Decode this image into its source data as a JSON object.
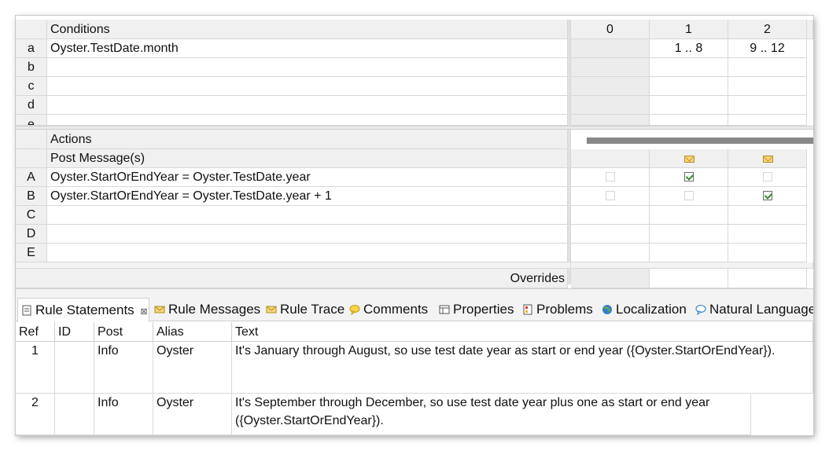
{
  "decision_table": {
    "conditions_header": "Conditions",
    "column_headers": [
      "0",
      "1",
      "2"
    ],
    "conditions": [
      {
        "letter": "a",
        "expr": "Oyster.TestDate.month",
        "values": [
          "",
          "1 .. 8",
          "9 .. 12"
        ]
      },
      {
        "letter": "b",
        "expr": "",
        "values": [
          "",
          "",
          ""
        ]
      },
      {
        "letter": "c",
        "expr": "",
        "values": [
          "",
          "",
          ""
        ]
      },
      {
        "letter": "d",
        "expr": "",
        "values": [
          "",
          "",
          ""
        ]
      },
      {
        "letter": "e",
        "expr": "",
        "values": [
          "",
          "",
          ""
        ]
      }
    ],
    "actions_header": "Actions",
    "post_message_label": "Post Message(s)",
    "actions": [
      {
        "letter": "A",
        "expr": "Oyster.StartOrEndYear = Oyster.TestDate.year",
        "checks": [
          false,
          true,
          false
        ]
      },
      {
        "letter": "B",
        "expr": "Oyster.StartOrEndYear = Oyster.TestDate.year + 1",
        "checks": [
          false,
          false,
          true
        ]
      },
      {
        "letter": "C",
        "expr": "",
        "checks": []
      },
      {
        "letter": "D",
        "expr": "",
        "checks": []
      },
      {
        "letter": "E",
        "expr": "",
        "checks": []
      }
    ],
    "overrides_label": "Overrides"
  },
  "tabs": [
    {
      "label": "Rule Statements",
      "icon": "document-icon",
      "active": true,
      "close": "⊠"
    },
    {
      "label": "Rule Messages",
      "icon": "envelope-icon"
    },
    {
      "label": "Rule Trace",
      "icon": "envelope-icon"
    },
    {
      "label": "Comments",
      "icon": "comment-icon"
    },
    {
      "label": "Properties",
      "icon": "properties-icon"
    },
    {
      "label": "Problems",
      "icon": "problems-icon"
    },
    {
      "label": "Localization",
      "icon": "globe-icon"
    },
    {
      "label": "Natural Language",
      "icon": "speech-bubble-icon"
    }
  ],
  "statements": {
    "columns": [
      "Ref",
      "ID",
      "Post",
      "Alias",
      "Text"
    ],
    "rows": [
      {
        "ref": "1",
        "id": "",
        "post": "Info",
        "alias": "Oyster",
        "text": "It's January through August, so use test date year as start or end year ({Oyster.StartOrEndYear})."
      },
      {
        "ref": "2",
        "id": "",
        "post": "Info",
        "alias": "Oyster",
        "text": "It's September through December, so use test date year plus one as start or end year ({Oyster.StartOrEndYear})."
      }
    ]
  },
  "colors": {
    "check": "#2f8a2f",
    "envelope": "#f5d77a",
    "scroll": "#888888"
  }
}
